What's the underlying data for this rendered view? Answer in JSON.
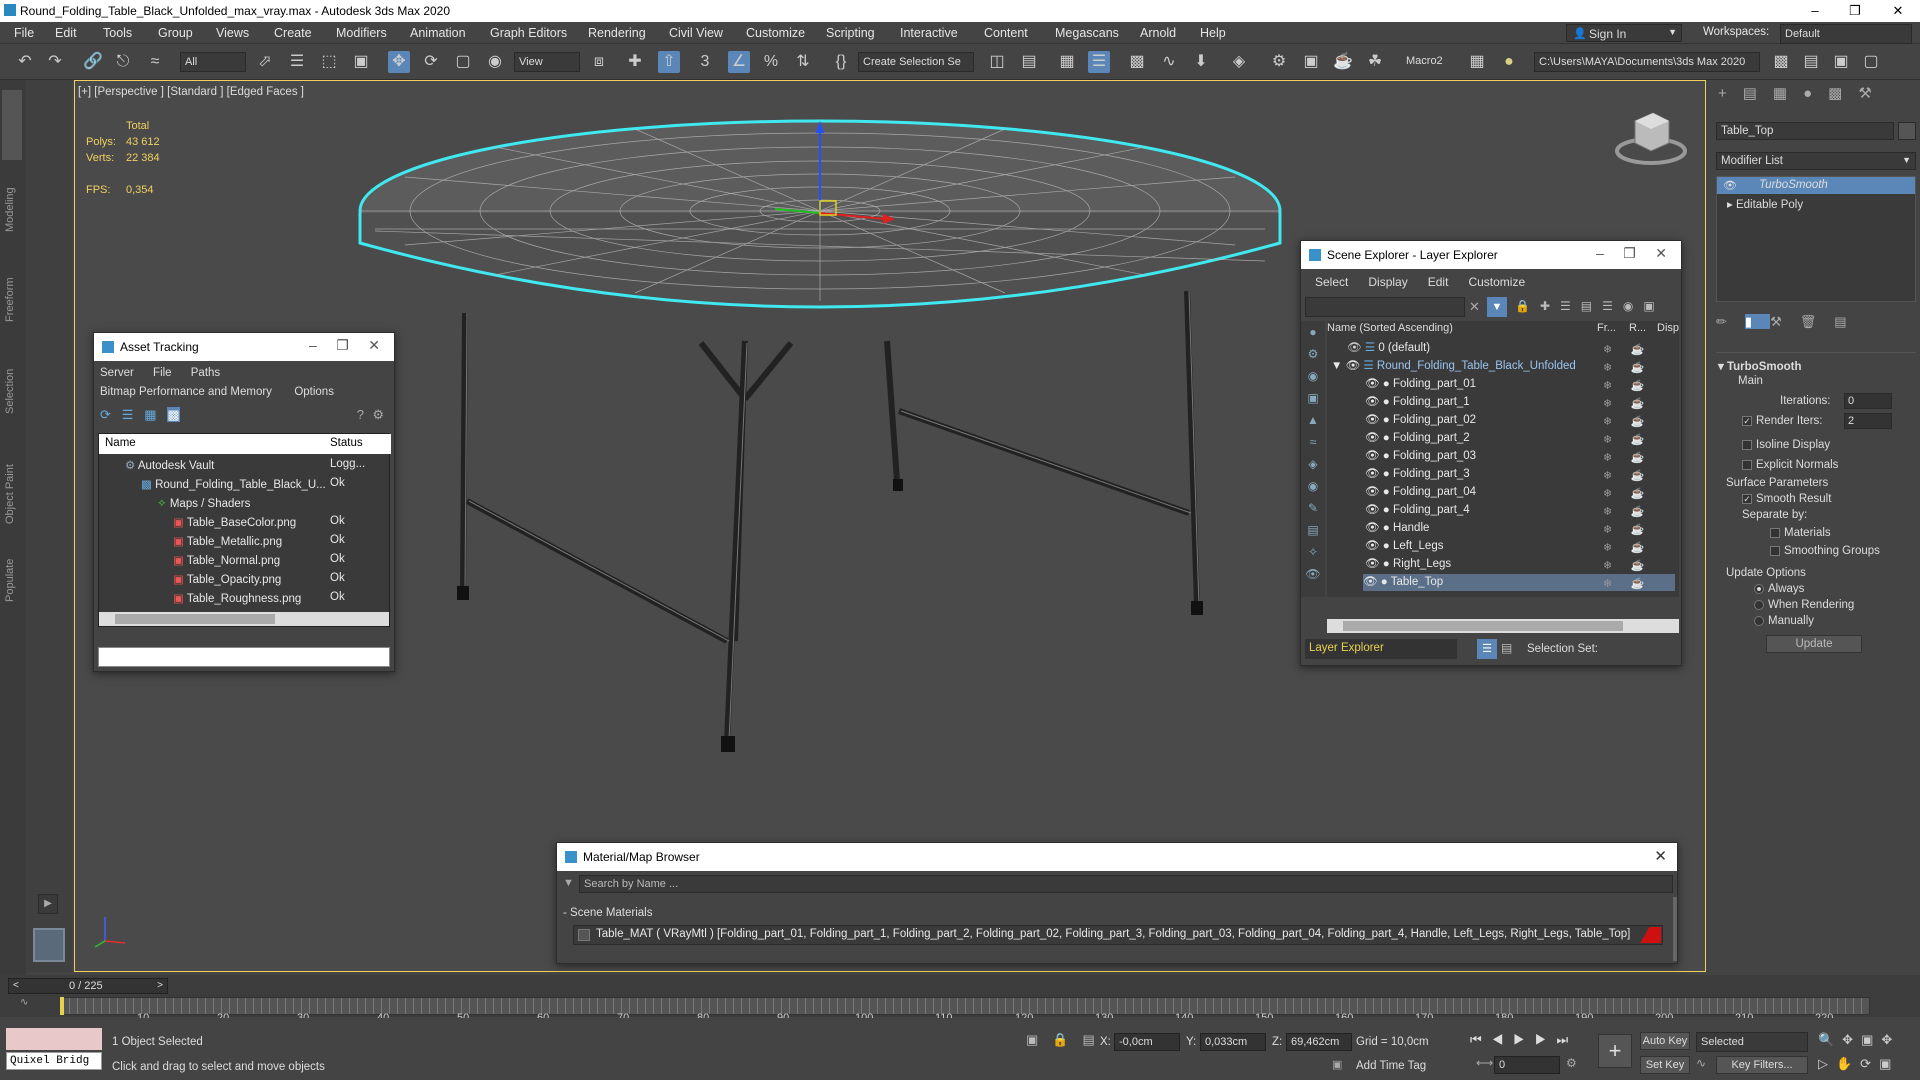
{
  "window": {
    "title": "Round_Folding_Table_Black_Unfolded_max_vray.max - Autodesk 3ds Max 2020"
  },
  "menu": [
    "File",
    "Edit",
    "Tools",
    "Group",
    "Views",
    "Create",
    "Modifiers",
    "Animation",
    "Graph Editors",
    "Rendering",
    "Civil View",
    "Customize",
    "Scripting",
    "Interactive",
    "Content",
    "Megascans",
    "Arnold",
    "Help"
  ],
  "account": {
    "sign_in": "Sign In",
    "workspaces_label": "Workspaces:",
    "workspace": "Default"
  },
  "toolbar": {
    "filter": "All",
    "view": "View",
    "selection_set": "Create Selection Se",
    "macro": "Macro2",
    "path": "C:\\Users\\MAYA\\Documents\\3ds Max 2020"
  },
  "left_tabs": [
    "Modeling",
    "Freeform",
    "Selection",
    "Object Paint",
    "Populate"
  ],
  "viewport": {
    "label": "[+] [Perspective ] [Standard ] [Edged Faces ]",
    "stats": {
      "total_label": "Total",
      "polys_label": "Polys:",
      "polys": "43 612",
      "verts_label": "Verts:",
      "verts": "22 384",
      "fps_label": "FPS:",
      "fps": "0,354"
    }
  },
  "command_panel": {
    "object_name": "Table_Top",
    "modifier_list": "Modifier List",
    "stack": [
      "TurboSmooth",
      "Editable Poly"
    ],
    "rollout_title": "TurboSmooth",
    "main": "Main",
    "iterations_label": "Iterations:",
    "iterations": "0",
    "render_iters_label": "Render Iters:",
    "render_iters": "2",
    "isoline": "Isoline Display",
    "explicit_normals": "Explicit Normals",
    "surface_params": "Surface Parameters",
    "smooth_result": "Smooth Result",
    "separate_by": "Separate by:",
    "materials": "Materials",
    "smoothing_groups": "Smoothing Groups",
    "update_options": "Update Options",
    "always": "Always",
    "when_rendering": "When Rendering",
    "manually": "Manually",
    "update_btn": "Update"
  },
  "asset_tracking": {
    "title": "Asset Tracking",
    "menu1": [
      "Server",
      "File",
      "Paths"
    ],
    "menu2": [
      "Bitmap Performance and Memory",
      "Options"
    ],
    "columns": [
      "Name",
      "Status"
    ],
    "rows": [
      {
        "name": "Autodesk Vault",
        "status": "Logg..."
      },
      {
        "name": "Round_Folding_Table_Black_U...",
        "status": "Ok"
      },
      {
        "name": "Maps / Shaders",
        "status": ""
      },
      {
        "name": "Table_BaseColor.png",
        "status": "Ok"
      },
      {
        "name": "Table_Metallic.png",
        "status": "Ok"
      },
      {
        "name": "Table_Normal.png",
        "status": "Ok"
      },
      {
        "name": "Table_Opacity.png",
        "status": "Ok"
      },
      {
        "name": "Table_Roughness.png",
        "status": "Ok"
      }
    ]
  },
  "scene_explorer": {
    "title": "Scene Explorer - Layer Explorer",
    "menu": [
      "Select",
      "Display",
      "Edit",
      "Customize"
    ],
    "columns": [
      "Name (Sorted Ascending)",
      "Fr...",
      "R...",
      "Disp"
    ],
    "rows": [
      {
        "name": "0 (default)"
      },
      {
        "name": "Round_Folding_Table_Black_Unfolded"
      },
      {
        "name": "Folding_part_01"
      },
      {
        "name": "Folding_part_1"
      },
      {
        "name": "Folding_part_02"
      },
      {
        "name": "Folding_part_2"
      },
      {
        "name": "Folding_part_03"
      },
      {
        "name": "Folding_part_3"
      },
      {
        "name": "Folding_part_04"
      },
      {
        "name": "Folding_part_4"
      },
      {
        "name": "Handle"
      },
      {
        "name": "Left_Legs"
      },
      {
        "name": "Right_Legs"
      },
      {
        "name": "Table_Top"
      }
    ],
    "footer_left": "Layer Explorer",
    "footer_right": "Selection Set:"
  },
  "material_browser": {
    "title": "Material/Map Browser",
    "search_placeholder": "Search by Name ...",
    "group": "- Scene Materials",
    "item": "Table_MAT ( VRayMtl ) [Folding_part_01, Folding_part_1, Folding_part_2, Folding_part_02, Folding_part_3, Folding_part_03, Folding_part_04, Folding_part_4, Handle, Left_Legs, Right_Legs, Table_Top]"
  },
  "timeline": {
    "frame": "0 / 225",
    "ticks": [
      "10",
      "20",
      "30",
      "40",
      "50",
      "60",
      "70",
      "80",
      "90",
      "100",
      "110",
      "120",
      "130",
      "140",
      "150",
      "160",
      "170",
      "180",
      "190",
      "200",
      "210",
      "220"
    ]
  },
  "status": {
    "quixel": "Quixel Bridg",
    "selected": "1 Object Selected",
    "hint": "Click and drag to select and move objects",
    "x_label": "X:",
    "x": "-0,0cm",
    "y_label": "Y:",
    "y": "0,033cm",
    "z_label": "Z:",
    "z": "69,462cm",
    "grid": "Grid = 10,0cm",
    "add_time_tag": "Add Time Tag",
    "auto_key": "Auto Key",
    "set_key": "Set Key",
    "selected_dd": "Selected",
    "key_filters": "Key Filters...",
    "frame_field": "0"
  }
}
